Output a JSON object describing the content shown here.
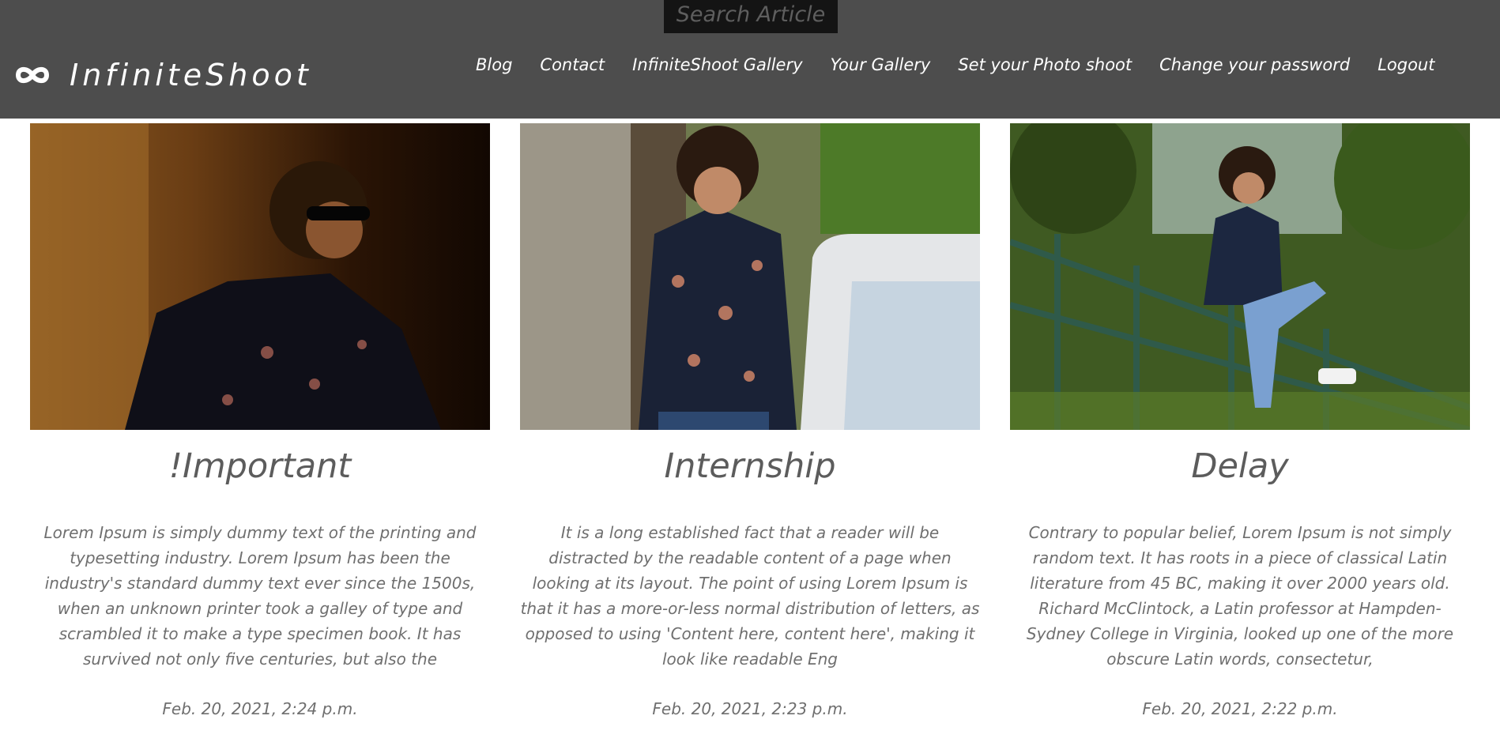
{
  "search": {
    "placeholder": "Search Article"
  },
  "brand": {
    "name": "InfiniteShoot",
    "icon": "infinity-icon"
  },
  "nav": {
    "items": [
      {
        "label": "Blog"
      },
      {
        "label": "Contact"
      },
      {
        "label": "InfiniteShoot Gallery"
      },
      {
        "label": "Your Gallery"
      },
      {
        "label": "Set your Photo shoot"
      },
      {
        "label": "Change your password"
      },
      {
        "label": "Logout"
      }
    ]
  },
  "articles": [
    {
      "title": "!Important",
      "excerpt": "Lorem Ipsum is simply dummy text of the printing and typesetting industry. Lorem Ipsum has been the industry's standard dummy text ever since the 1500s, when an unknown printer took a galley of type and scrambled it to make a type specimen book. It has survived not only five centuries, but also the",
      "date": "Feb. 20, 2021, 2:24 p.m."
    },
    {
      "title": "Internship",
      "excerpt": "It is a long established fact that a reader will be distracted by the readable content of a page when looking at its layout. The point of using Lorem Ipsum is that it has a more-or-less normal distribution of letters, as opposed to using 'Content here, content here', making it look like readable Eng",
      "date": "Feb. 20, 2021, 2:23 p.m."
    },
    {
      "title": "Delay",
      "excerpt": "Contrary to popular belief, Lorem Ipsum is not simply random text. It has roots in a piece of classical Latin literature from 45 BC, making it over 2000 years old. Richard McClintock, a Latin professor at Hampden-Sydney College in Virginia, looked up one of the more obscure Latin words, consectetur,",
      "date": "Feb. 20, 2021, 2:22 p.m."
    }
  ]
}
